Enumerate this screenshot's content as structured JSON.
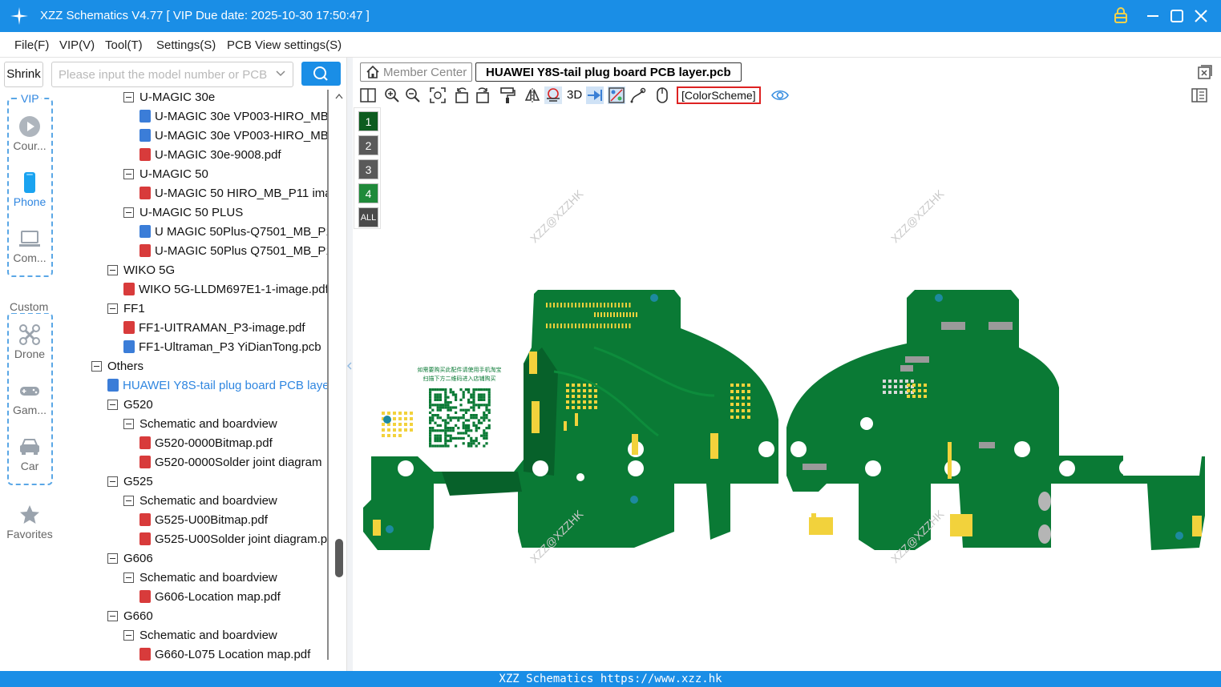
{
  "app": {
    "title": "XZZ Schematics V4.77 [ VIP Due date: 2025-10-30 17:50:47 ]"
  },
  "menu": [
    "File(F)",
    "VIP(V)",
    "Tool(T)",
    "Settings(S)",
    "PCB View settings(S)"
  ],
  "search": {
    "shrink_label": "Shrink",
    "placeholder": "Please input the model number or PCB"
  },
  "leftnav": {
    "vip_title": "VIP",
    "custom_title": "Custom",
    "items": [
      {
        "label": "Cour...",
        "icon": "play-circle-icon"
      },
      {
        "label": "Phone",
        "icon": "phone-icon"
      },
      {
        "label": "Com...",
        "icon": "laptop-icon"
      },
      {
        "label": "Drone",
        "icon": "drone-icon"
      },
      {
        "label": "Gam...",
        "icon": "gamepad-icon"
      },
      {
        "label": "Car",
        "icon": "car-icon"
      },
      {
        "label": "Favorites",
        "icon": "star-icon"
      }
    ]
  },
  "tree": [
    {
      "label": "U-MAGIC 30e",
      "type": "folder",
      "level": 2
    },
    {
      "label": "U-MAGIC 30e VP003-HIRO_MB_",
      "type": "pcb",
      "level": 3
    },
    {
      "label": "U-MAGIC 30e VP003-HIRO_MB_",
      "type": "pcb",
      "level": 3
    },
    {
      "label": "U-MAGIC 30e-9008.pdf",
      "type": "pdf",
      "level": 3
    },
    {
      "label": "U-MAGIC 50",
      "type": "folder",
      "level": 2
    },
    {
      "label": "U-MAGIC 50 HIRO_MB_P11 ima",
      "type": "pdf",
      "level": 3
    },
    {
      "label": "U-MAGIC 50 PLUS",
      "type": "folder",
      "level": 2
    },
    {
      "label": "U MAGIC 50Plus-Q7501_MB_P1",
      "type": "pcb",
      "level": 3
    },
    {
      "label": "U-MAGIC 50Plus Q7501_MB_P1",
      "type": "pdf",
      "level": 3
    },
    {
      "label": "WIKO 5G",
      "type": "folder",
      "level": 1
    },
    {
      "label": "WIKO 5G-LLDM697E1-1-image.pdf",
      "type": "pdf",
      "level": 2
    },
    {
      "label": "FF1",
      "type": "folder",
      "level": 1
    },
    {
      "label": "FF1-UITRAMAN_P3-image.pdf",
      "type": "pdf",
      "level": 2
    },
    {
      "label": "FF1-Ultraman_P3 YiDianTong.pcb",
      "type": "pcb",
      "level": 2
    },
    {
      "label": "Others",
      "type": "folder",
      "level": 0
    },
    {
      "label": "HUAWEI Y8S-tail plug board PCB laye",
      "type": "pcb",
      "level": 1,
      "selected": true
    },
    {
      "label": "G520",
      "type": "folder",
      "level": 1
    },
    {
      "label": "Schematic and boardview",
      "type": "folder",
      "level": 2
    },
    {
      "label": "G520-0000Bitmap.pdf",
      "type": "pdf",
      "level": 3
    },
    {
      "label": "G520-0000Solder joint diagram",
      "type": "pdf",
      "level": 3
    },
    {
      "label": "G525",
      "type": "folder",
      "level": 1
    },
    {
      "label": "Schematic and boardview",
      "type": "folder",
      "level": 2
    },
    {
      "label": "G525-U00Bitmap.pdf",
      "type": "pdf",
      "level": 3
    },
    {
      "label": "G525-U00Solder joint diagram.p",
      "type": "pdf",
      "level": 3
    },
    {
      "label": "G606",
      "type": "folder",
      "level": 1
    },
    {
      "label": "Schematic and boardview",
      "type": "folder",
      "level": 2
    },
    {
      "label": "G606-Location map.pdf",
      "type": "pdf",
      "level": 3
    },
    {
      "label": "G660",
      "type": "folder",
      "level": 1
    },
    {
      "label": "Schematic and boardview",
      "type": "folder",
      "level": 2
    },
    {
      "label": "G660-L075 Location map.pdf",
      "type": "pdf",
      "level": 3
    }
  ],
  "tabs": {
    "member_center": "Member Center",
    "active_file": "HUAWEI Y8S-tail plug board PCB layer.pcb"
  },
  "toolbar": {
    "three_d": "3D",
    "color_scheme": "[ColorScheme]"
  },
  "layers": [
    {
      "label": "1",
      "color": "#0d5c1f"
    },
    {
      "label": "2",
      "color": "#5a5a5a"
    },
    {
      "label": "3",
      "color": "#5a5a5a"
    },
    {
      "label": "4",
      "color": "#1f8a3a"
    },
    {
      "label": "ALL",
      "color": "#4a4a4a"
    }
  ],
  "canvas": {
    "watermark": "XZZ@XZZHK",
    "qr_caption_1": "如需要购买此配件请使用手机淘宝",
    "qr_caption_2": "扫描下方二维码进入店铺购买",
    "board_color": "#0a7a35",
    "pad_color": "#f2d23c"
  },
  "status": {
    "text": "XZZ Schematics https://www.xzz.hk"
  }
}
